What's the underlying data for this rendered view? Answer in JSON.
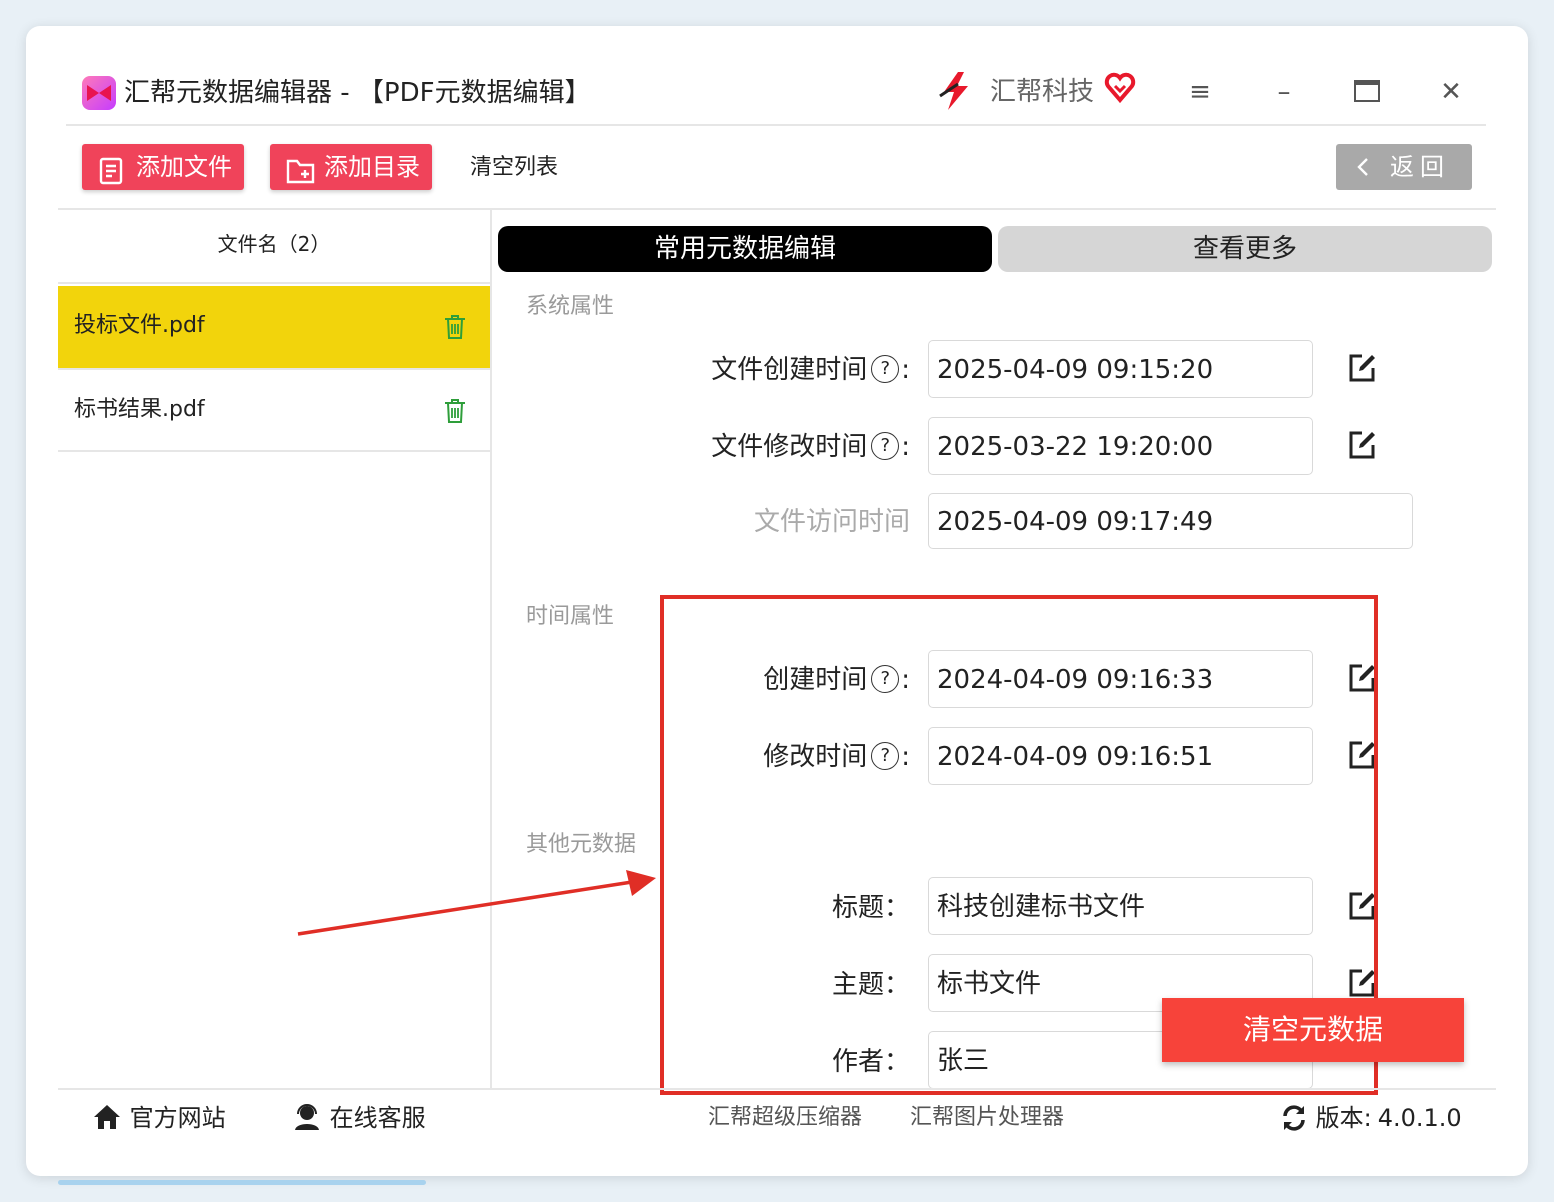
{
  "window": {
    "title": "汇帮元数据编辑器 - 【PDF元数据编辑】",
    "brand": "汇帮科技",
    "menu_icon": "menu-icon",
    "minimize_icon": "minimize-icon",
    "maximize_icon": "maximize-icon",
    "close_icon": "close-icon"
  },
  "toolbar": {
    "add_file": "添加文件",
    "add_folder": "添加目录",
    "clear_list": "清空列表",
    "back": "返回"
  },
  "file_list": {
    "header": "文件名（2）",
    "items": [
      {
        "name": "投标文件.pdf",
        "selected": true
      },
      {
        "name": "标书结果.pdf",
        "selected": false
      }
    ]
  },
  "tabs": {
    "common": "常用元数据编辑",
    "more": "查看更多"
  },
  "system_props": {
    "title": "系统属性",
    "fields": [
      {
        "label": "文件创建时间",
        "value": "2025-04-09 09:15:20",
        "editable": true,
        "help": true
      },
      {
        "label": "文件修改时间",
        "value": "2025-03-22 19:20:00",
        "editable": true,
        "help": true
      },
      {
        "label": "文件访问时间",
        "value": "2025-04-09 09:17:49",
        "editable": false,
        "help": false
      }
    ]
  },
  "time_props": {
    "title": "时间属性",
    "fields": [
      {
        "label": "创建时间",
        "value": "2024-04-09 09:16:33",
        "help": true
      },
      {
        "label": "修改时间",
        "value": "2024-04-09 09:16:51",
        "help": true
      }
    ]
  },
  "other_meta": {
    "title": "其他元数据",
    "fields": [
      {
        "label": "标题",
        "value": "科技创建标书文件"
      },
      {
        "label": "主题",
        "value": "标书文件"
      },
      {
        "label": "作者",
        "value": "张三"
      }
    ]
  },
  "actions": {
    "clear_metadata": "清空元数据"
  },
  "footer": {
    "website": "官方网站",
    "support": "在线客服",
    "compressor": "汇帮超级压缩器",
    "image_tool": "汇帮图片处理器",
    "version_label": "版本:",
    "version": "4.0.1.0"
  },
  "colors": {
    "accent_red": "#f0435a",
    "selected_yellow": "#f2d40c",
    "tab_active": "#000000",
    "annotation_red": "#e02e26",
    "clear_btn": "#f7433a"
  }
}
